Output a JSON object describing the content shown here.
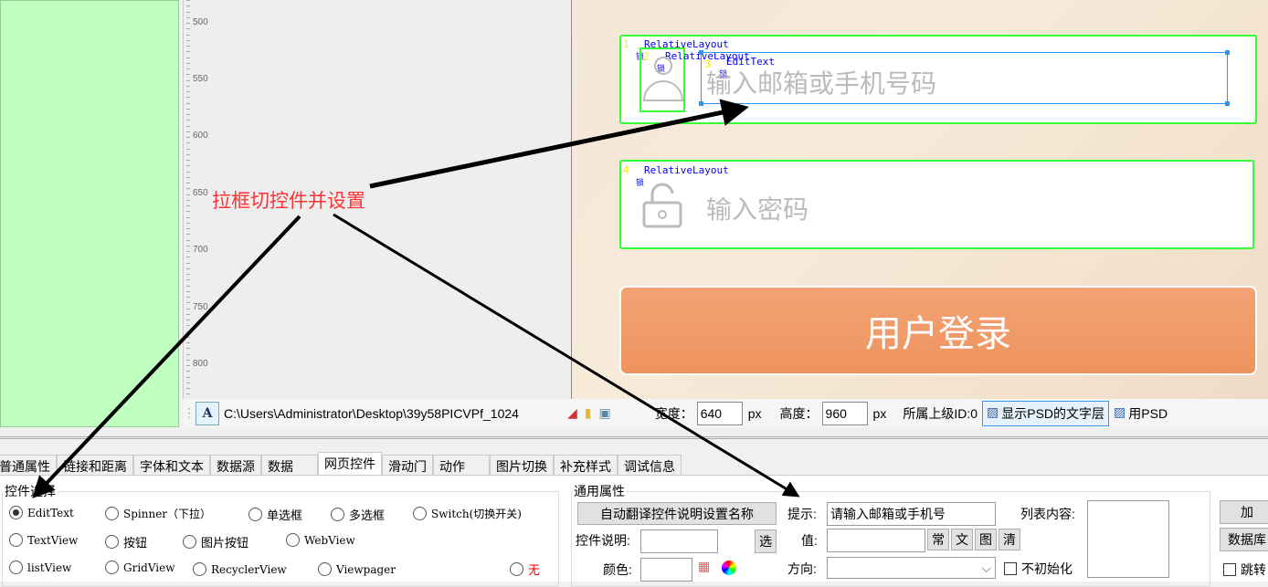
{
  "ruler": {
    "labels": [
      "500",
      "550",
      "600",
      "650",
      "700",
      "750",
      "800"
    ]
  },
  "annotation": "拉框切控件并设置",
  "canvas": {
    "box1": {
      "num": "1",
      "label": "RelativeLayout",
      "sub": "锁"
    },
    "box2": {
      "num": "2",
      "label": "RelativeLayout",
      "sub": "锁"
    },
    "box3": {
      "num": "3",
      "label": "EditText",
      "sub": "锁",
      "hint": "输入邮箱或手机号码"
    },
    "box4": {
      "num": "4",
      "label": "RelativeLayout",
      "sub": "锁",
      "hint": "输入密码"
    },
    "login": "用户登录"
  },
  "toolbar": {
    "path": "C:\\Users\\Administrator\\Desktop\\39y58PICVPf_1024",
    "width_label": "宽度：",
    "width": "640",
    "px": "px",
    "height_label": "高度：",
    "height": "960",
    "parent_id": "所属上级ID:0",
    "show_psd": "显示PSD的文字层",
    "use_psd": "用PSD"
  },
  "tabs": [
    "普通属性",
    "链接和距离",
    "字体和文本",
    "数据源",
    "数据",
    "网页控件",
    "滑动门",
    "动作",
    "图片切换",
    "补充样式",
    "调试信息"
  ],
  "active_tab": "网页控件",
  "control_select": {
    "title": "控件选择",
    "options": [
      "EditText",
      "Spinner（下拉）",
      "单选框",
      "多选框",
      "Switch(切换开关)",
      "TextView",
      "按钮",
      "图片按钮",
      "WebView",
      "listView",
      "GridView",
      "RecyclerView",
      "Viewpager",
      "无"
    ],
    "selected": "EditText"
  },
  "common": {
    "title": "通用属性",
    "auto_translate": "自动翻译控件说明设置名称",
    "desc_label": "控件说明:",
    "desc_value": "",
    "select_btn": "选",
    "color_label": "颜色:",
    "hint_label": "提示:",
    "hint_value": "请输入邮箱或手机号",
    "value_label": "值:",
    "value_value": "",
    "btn_chang": "常",
    "btn_wen": "文",
    "btn_tu": "图",
    "btn_qing": "清",
    "direction_label": "方向:",
    "direction_value": "",
    "no_init": "不初始化",
    "list_label": "列表内容:",
    "add_btn": "加",
    "db_btn": "数据库",
    "jump": "跳转"
  }
}
